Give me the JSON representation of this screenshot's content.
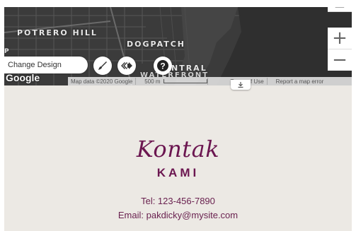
{
  "map": {
    "labels": {
      "potrero_hill": "POTRERO HILL",
      "dogpatch": "DOGPATCH",
      "central": "NTRAL",
      "waterfront": "WATERFRONT",
      "side_letter": "P"
    },
    "change_design_label": "Change Design",
    "google_label": "Google",
    "footer": {
      "map_data": "Map data ©2020 Google",
      "scale": "500 m",
      "terms": "Terms of Use",
      "report": "Report a map error"
    },
    "zoom_in": "+",
    "zoom_out": "−",
    "zoom_partial": "−"
  },
  "contact": {
    "title": "Kontak",
    "subtitle": "KAMI",
    "tel": "Tel: 123-456-7890",
    "email": "Email: pakdicky@mysite.com"
  },
  "colors": {
    "accent": "#6b1650",
    "map_bg": "#3f3f3f",
    "page_bg": "#ece9e4"
  },
  "icons": {
    "edit": "paint-brush-icon",
    "animation": "animation-arrows-icon",
    "help": "help-icon",
    "download": "download-icon"
  }
}
